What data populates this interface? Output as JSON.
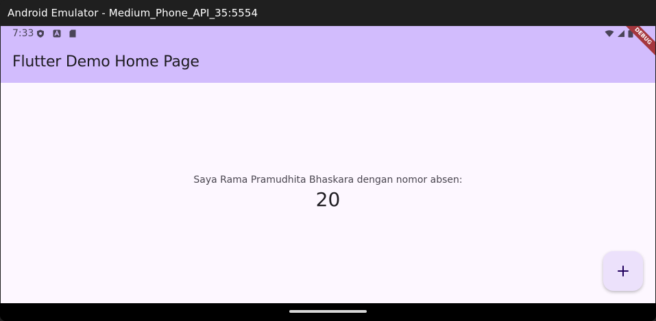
{
  "window": {
    "title": "Android Emulator - Medium_Phone_API_35:5554"
  },
  "status_bar": {
    "time": "7:33",
    "icons_left": [
      "shield-icon",
      "a-icon",
      "sd-card-icon"
    ],
    "icons_right": [
      "wifi-icon",
      "signal-icon",
      "battery-icon"
    ]
  },
  "app_bar": {
    "title": "Flutter Demo Home Page",
    "debug_banner": "DEBUG",
    "color": "#d2bcfd"
  },
  "body": {
    "message": "Saya Rama Pramudhita Bhaskara dengan nomor absen:",
    "counter": "20"
  },
  "fab": {
    "icon": "plus-icon",
    "color": "#ece1fb"
  }
}
